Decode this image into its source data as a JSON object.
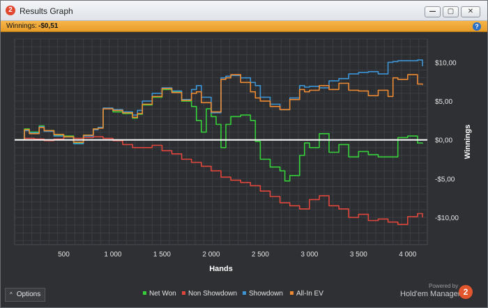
{
  "window": {
    "title": "Results Graph",
    "app_icon_glyph": "2",
    "minimize_glyph": "—",
    "maximize_glyph": "▢",
    "close_glyph": "✕"
  },
  "winnings_bar": {
    "label": "Winnings:",
    "value": "-$0,51",
    "help_glyph": "?"
  },
  "options": {
    "chevron": "^",
    "label": "Options"
  },
  "legend": [
    {
      "label": "Net Won",
      "color": "#36d13a"
    },
    {
      "label": "Non Showdown",
      "color": "#e0463c"
    },
    {
      "label": "Showdown",
      "color": "#3d95d6"
    },
    {
      "label": "All-In EV",
      "color": "#ee8a32"
    }
  ],
  "branding": {
    "powered_by": "Powered by",
    "name": "Hold'em Manager",
    "logo_glyph": "2"
  },
  "chart_data": {
    "type": "line",
    "xlabel": "Hands",
    "ylabel": "Winnings",
    "xlim": [
      0,
      4200
    ],
    "ylim": [
      -13.5,
      13
    ],
    "x_ticks": [
      500,
      1000,
      1500,
      2000,
      2500,
      3000,
      3500,
      4000
    ],
    "x_tick_labels": [
      "500",
      "1 000",
      "1 500",
      "2 000",
      "2 500",
      "3 000",
      "3 500",
      "4 000"
    ],
    "y_ticks": [
      10,
      5,
      0,
      -5,
      -10
    ],
    "y_tick_labels": [
      "$10,00",
      "$5,00",
      "$0,00",
      "-$5,00",
      "-$10,00"
    ],
    "grid": true,
    "zero_line_color": "#ffffff",
    "series": [
      {
        "name": "Net Won",
        "color": "#36d13a",
        "x": [
          0,
          100,
          150,
          250,
          300,
          400,
          500,
          600,
          700,
          800,
          850,
          900,
          1000,
          1100,
          1200,
          1250,
          1300,
          1400,
          1500,
          1600,
          1700,
          1800,
          1850,
          1900,
          1950,
          2000,
          2050,
          2100,
          2150,
          2200,
          2300,
          2400,
          2450,
          2500,
          2600,
          2700,
          2750,
          2800,
          2900,
          2950,
          3000,
          3100,
          3200,
          3300,
          3400,
          3500,
          3600,
          3700,
          3800,
          3900,
          4000,
          4100,
          4150
        ],
        "y": [
          0,
          1.4,
          1.0,
          1.8,
          1.2,
          0.6,
          0.5,
          -0.4,
          0.6,
          1.4,
          1.6,
          4.0,
          3.6,
          3.4,
          2.8,
          3.3,
          4.5,
          5.5,
          6.5,
          6.2,
          5.0,
          4.3,
          2.5,
          1.0,
          4.0,
          3.0,
          2.0,
          -1.0,
          2.0,
          3.0,
          3.2,
          2.5,
          -0.2,
          -2.5,
          -3.5,
          -4.0,
          -5.3,
          -4.6,
          -2.0,
          -0.4,
          -1.0,
          0.8,
          -1.6,
          -0.6,
          -2.2,
          -1.5,
          -1.9,
          -2.2,
          -2.2,
          0.3,
          0.5,
          -0.4,
          -0.5
        ]
      },
      {
        "name": "Non Showdown",
        "color": "#e0463c",
        "x": [
          0,
          100,
          200,
          300,
          400,
          500,
          600,
          700,
          800,
          900,
          1000,
          1100,
          1200,
          1300,
          1400,
          1500,
          1600,
          1700,
          1800,
          1900,
          2000,
          2100,
          2200,
          2300,
          2400,
          2500,
          2600,
          2700,
          2800,
          2900,
          3000,
          3100,
          3200,
          3300,
          3400,
          3500,
          3600,
          3700,
          3800,
          3900,
          4000,
          4100,
          4150
        ],
        "y": [
          0,
          0.2,
          0.1,
          -0.1,
          0.1,
          0.4,
          0.2,
          0.3,
          0.4,
          0.2,
          -0.1,
          -0.6,
          -1.0,
          -1.0,
          -0.7,
          -1.4,
          -1.8,
          -2.5,
          -2.9,
          -3.4,
          -4.0,
          -4.8,
          -5.2,
          -5.5,
          -5.9,
          -6.6,
          -7.3,
          -8.1,
          -8.5,
          -8.9,
          -7.7,
          -7.2,
          -8.5,
          -8.9,
          -10.0,
          -9.6,
          -10.4,
          -10.2,
          -10.6,
          -10.9,
          -9.9,
          -9.5,
          -10.0
        ]
      },
      {
        "name": "Showdown",
        "color": "#3d95d6",
        "x": [
          0,
          100,
          150,
          250,
          300,
          400,
          500,
          600,
          700,
          800,
          850,
          900,
          1000,
          1100,
          1200,
          1250,
          1300,
          1400,
          1500,
          1600,
          1700,
          1800,
          1850,
          1900,
          2000,
          2100,
          2150,
          2200,
          2300,
          2400,
          2450,
          2500,
          2600,
          2700,
          2800,
          2900,
          2950,
          3000,
          3100,
          3200,
          3300,
          3400,
          3500,
          3600,
          3700,
          3800,
          3850,
          3900,
          4000,
          4100,
          4150
        ],
        "y": [
          0,
          1.2,
          0.9,
          1.7,
          1.1,
          0.5,
          0.4,
          -0.5,
          0.5,
          1.3,
          1.6,
          4.1,
          3.9,
          3.6,
          3.2,
          3.8,
          5.0,
          6.0,
          6.7,
          6.3,
          5.2,
          6.5,
          7.0,
          5.5,
          3.5,
          8.0,
          8.2,
          8.3,
          8.0,
          7.4,
          7.0,
          5.5,
          4.6,
          3.9,
          5.4,
          7.0,
          6.8,
          6.9,
          6.7,
          7.6,
          7.9,
          8.5,
          8.7,
          8.8,
          8.5,
          10.0,
          10.1,
          10.2,
          10.2,
          10.3,
          9.5
        ]
      },
      {
        "name": "All-In EV",
        "color": "#ee8a32",
        "x": [
          0,
          100,
          150,
          250,
          300,
          400,
          500,
          600,
          700,
          800,
          850,
          900,
          1000,
          1100,
          1200,
          1250,
          1300,
          1400,
          1500,
          1600,
          1700,
          1800,
          1850,
          1900,
          2000,
          2100,
          2150,
          2200,
          2300,
          2400,
          2450,
          2500,
          2600,
          2700,
          2800,
          2900,
          2950,
          3000,
          3100,
          3200,
          3300,
          3400,
          3500,
          3600,
          3700,
          3800,
          3850,
          3900,
          4000,
          4100,
          4150
        ],
        "y": [
          0,
          1.3,
          0.8,
          1.6,
          1.2,
          0.7,
          0.4,
          -0.3,
          0.6,
          1.4,
          1.5,
          4.0,
          3.8,
          3.5,
          2.9,
          3.4,
          4.6,
          5.6,
          6.6,
          6.1,
          5.1,
          6.0,
          6.2,
          4.8,
          3.6,
          7.8,
          8.0,
          8.4,
          7.4,
          6.2,
          5.4,
          5.0,
          4.3,
          3.9,
          5.2,
          6.5,
          6.2,
          6.4,
          7.0,
          6.5,
          7.3,
          6.4,
          6.3,
          5.7,
          6.4,
          5.6,
          8.0,
          7.8,
          8.4,
          7.2,
          7.1
        ]
      }
    ]
  }
}
